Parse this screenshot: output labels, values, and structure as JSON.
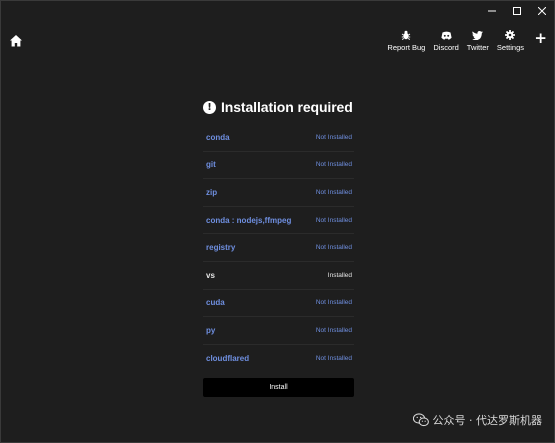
{
  "window": {
    "minimize_icon": "minimize-icon",
    "maximize_icon": "maximize-icon",
    "close_icon": "close-icon"
  },
  "nav": {
    "home_icon": "home-icon",
    "items": [
      {
        "label": "Report Bug",
        "icon": "bug-icon"
      },
      {
        "label": "Discord",
        "icon": "discord-icon"
      },
      {
        "label": "Twitter",
        "icon": "twitter-icon"
      },
      {
        "label": "Settings",
        "icon": "gear-icon"
      }
    ],
    "plus_label": "+"
  },
  "panel": {
    "title": "Installation required",
    "alert_glyph": "!",
    "dependencies": [
      {
        "name": "conda",
        "status": "Not Installed",
        "installed": false
      },
      {
        "name": "git",
        "status": "Not Installed",
        "installed": false
      },
      {
        "name": "zip",
        "status": "Not Installed",
        "installed": false
      },
      {
        "name": "conda : nodejs,ffmpeg",
        "status": "Not Installed",
        "installed": false
      },
      {
        "name": "registry",
        "status": "Not Installed",
        "installed": false
      },
      {
        "name": "vs",
        "status": "Installed",
        "installed": true
      },
      {
        "name": "cuda",
        "status": "Not Installed",
        "installed": false
      },
      {
        "name": "py",
        "status": "Not Installed",
        "installed": false
      },
      {
        "name": "cloudflared",
        "status": "Not Installed",
        "installed": false
      }
    ],
    "install_label": "Install"
  },
  "watermark": {
    "text": "公众号 · 代达罗斯机器"
  },
  "colors": {
    "background": "#1e1e1e",
    "not_installed": "#6f8fe0",
    "installed": "#e6e6e6",
    "button_bg": "#000000"
  }
}
